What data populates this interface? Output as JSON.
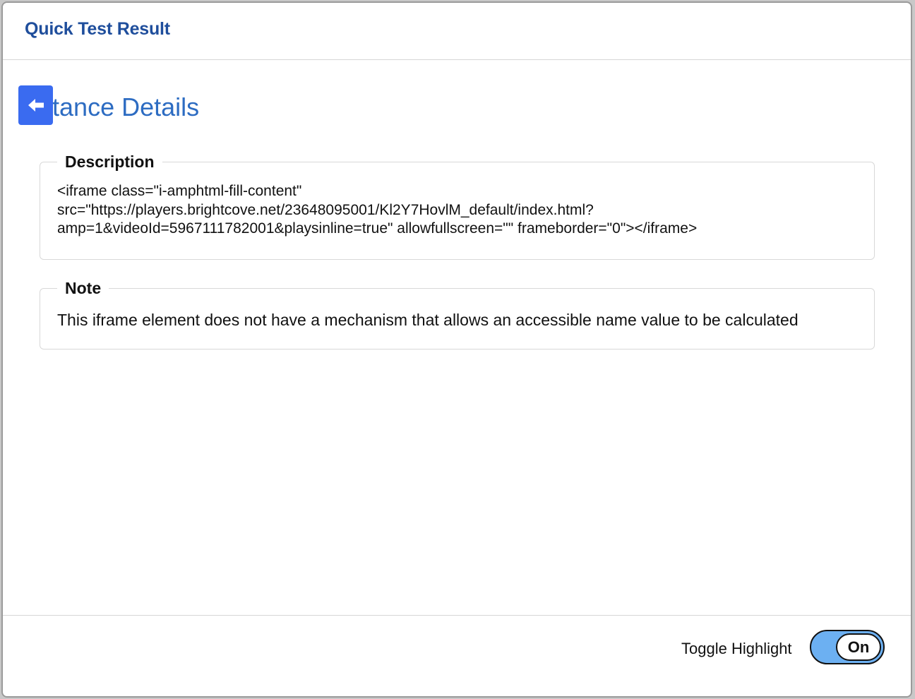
{
  "header": {
    "title": "Quick Test Result"
  },
  "section": {
    "back_icon": "arrow-left-icon",
    "heading": "Instance Details"
  },
  "description": {
    "legend": "Description",
    "text": "<iframe class=\"i-amphtml-fill-content\" src=\"https://players.brightcove.net/23648095001/Kl2Y7HovlM_default/index.html?amp=1&videoId=5967111782001&playsinline=true\" allowfullscreen=\"\" frameborder=\"0\"></iframe>"
  },
  "note": {
    "legend": "Note",
    "text": "This iframe element does not have a mechanism that allows an accessible name value to be calculated"
  },
  "footer": {
    "toggle_label": "Toggle Highlight",
    "toggle_state": "On"
  },
  "colors": {
    "title": "#1f4e9c",
    "heading": "#2d6cc2",
    "back_button": "#3a6bf0",
    "toggle_track": "#6cb0f2"
  }
}
